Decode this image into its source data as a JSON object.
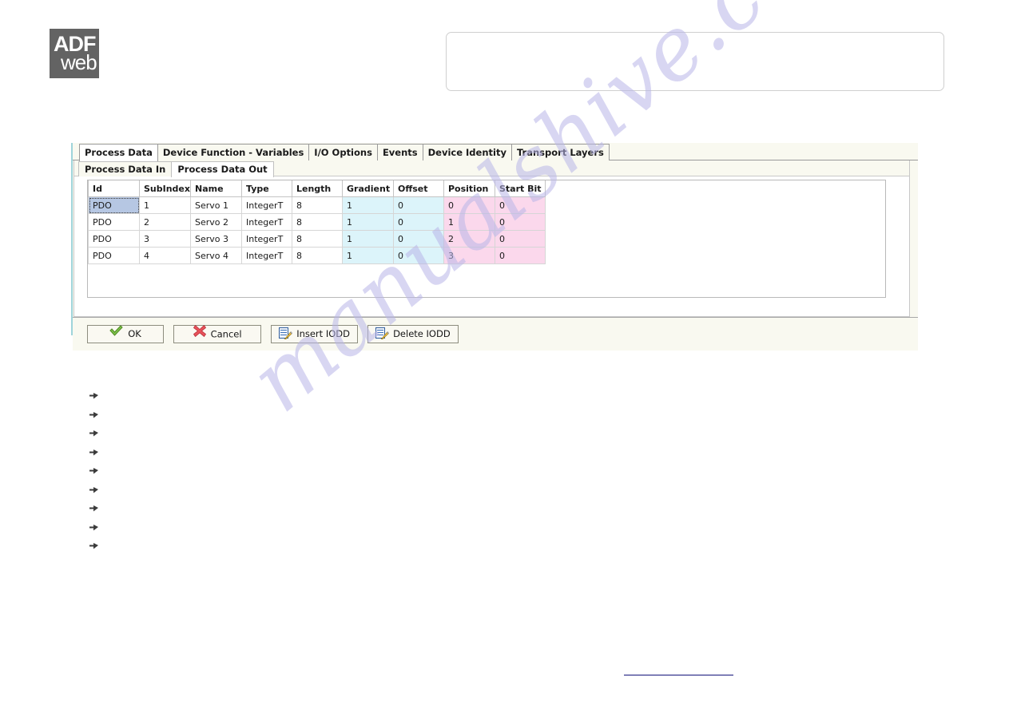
{
  "logo": {
    "line1": "ADF",
    "line2": "web"
  },
  "header_box": {
    "text": ""
  },
  "dialog": {
    "outer_tabs": [
      {
        "label": "Process Data",
        "active": true
      },
      {
        "label": "Device Function - Variables",
        "active": false
      },
      {
        "label": "I/O Options",
        "active": false
      },
      {
        "label": "Events",
        "active": false
      },
      {
        "label": "Device Identity",
        "active": false
      },
      {
        "label": "Transport Layers",
        "active": false
      }
    ],
    "inner_tabs": [
      {
        "label": "Process Data In",
        "active": false
      },
      {
        "label": "Process Data Out",
        "active": true
      }
    ],
    "grid": {
      "columns": [
        "Id",
        "SubIndex",
        "Name",
        "Type",
        "Length",
        "Gradient",
        "Offset",
        "Position",
        "Start Bit"
      ],
      "rows": [
        {
          "id": "PDO",
          "subindex": "1",
          "name": "Servo 1",
          "type": "IntegerT",
          "length": "8",
          "gradient": "1",
          "offset": "0",
          "position": "0",
          "start_bit": "0",
          "selected": true
        },
        {
          "id": "PDO",
          "subindex": "2",
          "name": "Servo 2",
          "type": "IntegerT",
          "length": "8",
          "gradient": "1",
          "offset": "0",
          "position": "1",
          "start_bit": "0",
          "selected": false
        },
        {
          "id": "PDO",
          "subindex": "3",
          "name": "Servo 3",
          "type": "IntegerT",
          "length": "8",
          "gradient": "1",
          "offset": "0",
          "position": "2",
          "start_bit": "0",
          "selected": false
        },
        {
          "id": "PDO",
          "subindex": "4",
          "name": "Servo 4",
          "type": "IntegerT",
          "length": "8",
          "gradient": "1",
          "offset": "0",
          "position": "3",
          "start_bit": "0",
          "selected": false
        }
      ],
      "colors": {
        "gradient_offset_bg": "#dcf4fa",
        "position_startbit_bg": "#fbd8ec",
        "selection_bg": "#b6c7e3"
      }
    },
    "buttons": [
      {
        "label": "OK",
        "icon": "green-check-icon"
      },
      {
        "label": "Cancel",
        "icon": "red-cross-icon"
      },
      {
        "label": "Insert IODD",
        "icon": "document-pencil-icon"
      },
      {
        "label": "Delete IODD",
        "icon": "document-pencil-icon"
      }
    ]
  },
  "bullet_list": [
    {
      "text": ""
    },
    {
      "text": ""
    },
    {
      "text": ""
    },
    {
      "text": ""
    },
    {
      "text": ""
    },
    {
      "text": ""
    },
    {
      "text": ""
    },
    {
      "text": ""
    },
    {
      "text": ""
    }
  ],
  "watermark": {
    "text": "manualshive.com"
  },
  "bottom_link": {
    "text": ""
  }
}
